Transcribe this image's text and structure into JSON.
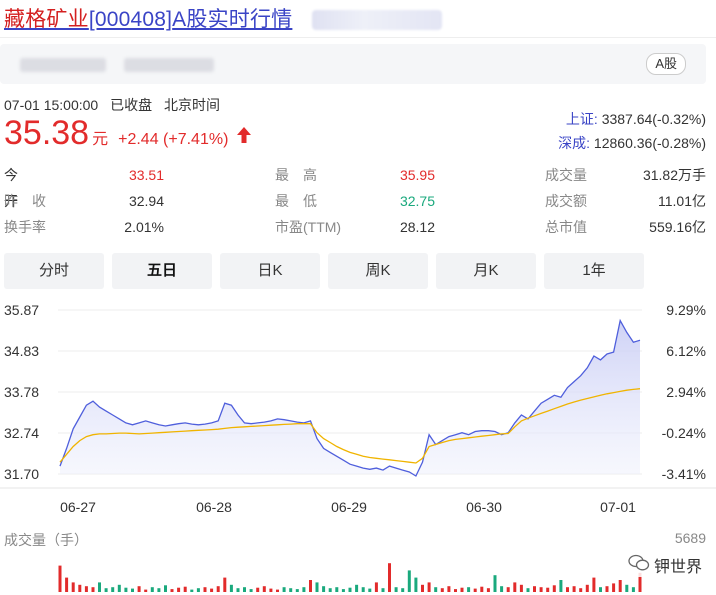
{
  "header": {
    "title_name": "藏格矿业",
    "title_code": "[000408]",
    "title_suffix": "A股实时行情",
    "market_tag": "A股"
  },
  "quote": {
    "datetime": "07-01 15:00:00",
    "status": "已收盘",
    "timezone": "北京时间",
    "price": "35.38",
    "currency": "元",
    "change": "+2.44 (+7.41%)"
  },
  "indices": [
    {
      "name": "上证:",
      "value": "3387.64(-0.32%)"
    },
    {
      "name": "深成:",
      "value": "12860.36(-0.28%)"
    }
  ],
  "stats": [
    {
      "label": "今　开",
      "value": "33.51",
      "tone": "red"
    },
    {
      "label": "最　高",
      "value": "35.95",
      "tone": "red"
    },
    {
      "label": "成交量",
      "value": "31.82万手",
      "tone": "normal"
    },
    {
      "label": "昨　收",
      "value": "32.94",
      "tone": "normal"
    },
    {
      "label": "最　低",
      "value": "32.75",
      "tone": "green"
    },
    {
      "label": "成交额",
      "value": "11.01亿",
      "tone": "normal"
    },
    {
      "label": "换手率",
      "value": "2.01%",
      "tone": "normal"
    },
    {
      "label": "市盈(TTM)",
      "value": "28.12",
      "tone": "normal"
    },
    {
      "label": "总市值",
      "value": "559.16亿",
      "tone": "normal"
    }
  ],
  "tabs": [
    "分时",
    "五日",
    "日K",
    "周K",
    "月K",
    "1年"
  ],
  "active_tab": "五日",
  "colors": {
    "up": "#e22b2b",
    "down": "#1aa97d",
    "link": "#3a44c6",
    "price_line": "#4f5fdc",
    "avg_line": "#f0b400"
  },
  "chart_data": {
    "type": "line",
    "y_ticks_left": [
      "35.87",
      "34.83",
      "33.78",
      "32.74",
      "31.70"
    ],
    "y_ticks_right": [
      "9.29%",
      "6.12%",
      "2.94%",
      "-0.24%",
      "-3.41%"
    ],
    "x_ticks": [
      "06-27",
      "06-28",
      "06-29",
      "06-30",
      "07-01"
    ],
    "ylim": [
      31.7,
      35.87
    ],
    "volume_label": "成交量（手）",
    "volume_max": "5689",
    "series": [
      {
        "values": [
          31.9,
          32.35,
          32.85,
          33.15,
          33.45,
          33.55,
          33.4,
          33.3,
          33.2,
          33.1,
          33.0,
          32.95,
          33.0,
          33.05,
          33.0,
          32.95,
          32.92,
          32.95,
          32.98,
          33.0,
          32.97,
          32.95,
          32.97,
          33.0,
          33.05,
          33.5,
          33.45,
          33.2,
          33.0,
          32.98,
          33.0,
          33.02,
          33.05,
          33.1,
          33.08,
          33.05,
          33.02,
          33.0,
          33.05,
          32.6,
          32.35,
          32.25,
          32.15,
          32.05,
          31.95,
          31.9,
          31.85,
          31.82,
          31.85,
          31.8,
          31.9,
          31.85,
          31.8,
          31.75,
          31.65,
          32.0,
          32.7,
          32.45,
          32.55,
          32.65,
          32.7,
          32.75,
          32.7,
          32.78,
          32.8,
          32.8,
          32.78,
          32.7,
          32.75,
          33.0,
          33.2,
          33.1,
          33.3,
          33.5,
          33.6,
          33.7,
          33.65,
          33.9,
          34.05,
          34.2,
          34.4,
          34.7,
          34.6,
          34.75,
          34.8,
          35.6,
          35.3,
          35.05,
          35.1
        ]
      },
      {
        "values": [
          32.0,
          32.2,
          32.4,
          32.55,
          32.65,
          32.7,
          32.72,
          32.72,
          32.73,
          32.74,
          32.74,
          32.73,
          32.72,
          32.73,
          32.74,
          32.75,
          32.76,
          32.77,
          32.78,
          32.79,
          32.8,
          32.81,
          32.82,
          32.83,
          32.84,
          32.86,
          32.88,
          32.89,
          32.9,
          32.91,
          32.92,
          32.93,
          32.94,
          32.95,
          32.96,
          32.97,
          32.98,
          32.98,
          32.98,
          32.75,
          32.6,
          32.5,
          32.4,
          32.32,
          32.25,
          32.2,
          32.15,
          32.12,
          32.1,
          32.08,
          32.06,
          32.04,
          32.02,
          32.0,
          31.98,
          32.1,
          32.4,
          32.45,
          32.5,
          32.55,
          32.58,
          32.6,
          32.62,
          32.64,
          32.66,
          32.68,
          32.7,
          32.72,
          32.73,
          32.9,
          33.05,
          33.12,
          33.18,
          33.24,
          33.3,
          33.36,
          33.42,
          33.48,
          33.53,
          33.58,
          33.62,
          33.66,
          33.7,
          33.74,
          33.77,
          33.8,
          33.83,
          33.85,
          33.87
        ]
      }
    ],
    "volumes": [
      0.55,
      0.3,
      0.2,
      0.15,
      0.12,
      0.1,
      0.2,
      0.08,
      0.1,
      0.15,
      0.09,
      0.07,
      0.12,
      0.05,
      0.1,
      0.08,
      0.14,
      0.06,
      0.09,
      0.11,
      0.05,
      0.08,
      0.1,
      0.07,
      0.12,
      0.3,
      0.15,
      0.08,
      0.1,
      0.06,
      0.09,
      0.12,
      0.07,
      0.05,
      0.1,
      0.08,
      0.06,
      0.1,
      0.25,
      0.2,
      0.12,
      0.08,
      0.1,
      0.06,
      0.09,
      0.15,
      0.1,
      0.07,
      0.2,
      0.08,
      0.6,
      0.1,
      0.08,
      0.45,
      0.3,
      0.15,
      0.2,
      0.1,
      0.08,
      0.12,
      0.06,
      0.09,
      0.1,
      0.07,
      0.11,
      0.08,
      0.35,
      0.12,
      0.1,
      0.2,
      0.15,
      0.08,
      0.12,
      0.1,
      0.09,
      0.14,
      0.25,
      0.1,
      0.12,
      0.08,
      0.15,
      0.3,
      0.1,
      0.12,
      0.18,
      0.25,
      0.15,
      0.1,
      0.4
    ]
  }
}
